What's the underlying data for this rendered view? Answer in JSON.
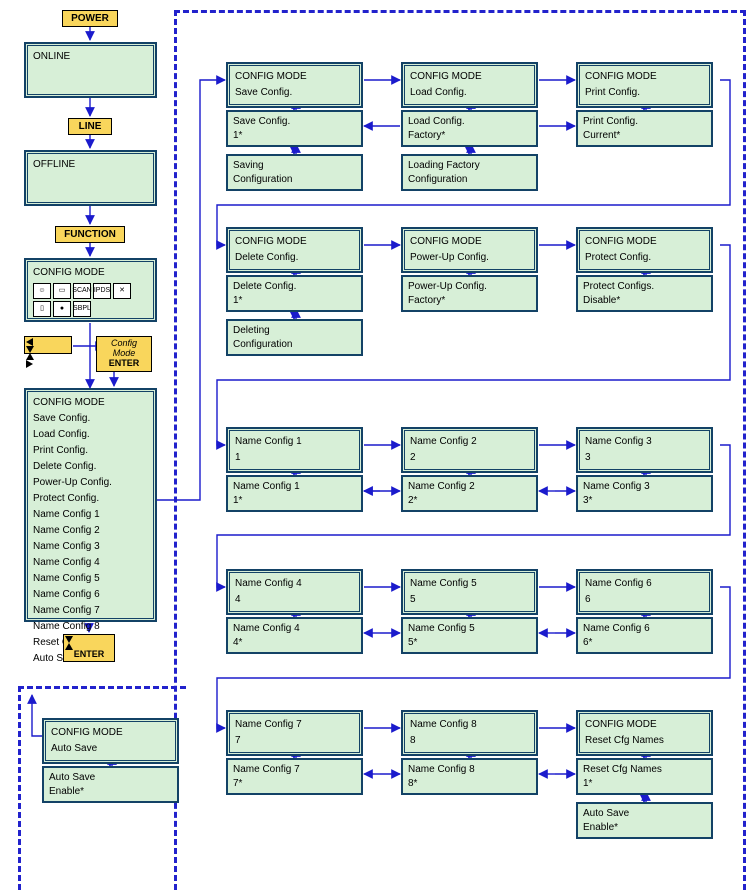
{
  "buttons": {
    "power": "POWER",
    "line": "LINE",
    "function": "FUNCTION",
    "config_mode": "Config Mode",
    "enter": "ENTER",
    "enter2": "ENTER"
  },
  "screens": {
    "online": "ONLINE",
    "offline": "OFFLINE",
    "config_mode": "CONFIG MODE",
    "menu_title": "CONFIG MODE",
    "menu": [
      "Save Config.",
      "Load Config.",
      "Print Config.",
      "Delete Config.",
      "Power-Up Config.",
      "Protect Config.",
      "Name Config 1",
      "Name Config 2",
      "Name Config 3",
      "Name Config 4",
      "Name Config 5",
      "Name Config 6",
      "Name Config 7",
      "Name Config 8",
      "Reset Cfg Names",
      "Auto Save"
    ]
  },
  "icons": {
    "face": "☺",
    "box": "▭",
    "scan": "SCAN",
    "ipds": "IPDS",
    "tools": "✕",
    "doc": "▯",
    "led": "●",
    "sbpl": "SBPL"
  },
  "row1": {
    "save": {
      "t": "CONFIG MODE",
      "s": "Save Config.",
      "p1": "Save Config.",
      "p2": "1*",
      "r1": "Saving",
      "r2": "Configuration"
    },
    "load": {
      "t": "CONFIG MODE",
      "s": "Load Config.",
      "p1": "Load Config.",
      "p2": "Factory*",
      "r1": "Loading Factory",
      "r2": "Configuration"
    },
    "print": {
      "t": "CONFIG MODE",
      "s": "Print Config.",
      "p1": "Print Config.",
      "p2": "Current*"
    }
  },
  "row2": {
    "del": {
      "t": "CONFIG MODE",
      "s": "Delete Config.",
      "p1": "Delete Config.",
      "p2": "1*",
      "r1": "Deleting",
      "r2": "Configuration"
    },
    "pow": {
      "t": "CONFIG MODE",
      "s": "Power-Up Config.",
      "p1": "Power-Up Config.",
      "p2": "Factory*"
    },
    "prot": {
      "t": "CONFIG MODE",
      "s": "Protect Config.",
      "p1": "Protect Configs.",
      "p2": "Disable*"
    }
  },
  "row3": {
    "a": {
      "t": "Name Config 1",
      "s": "1",
      "p1": "Name Config 1",
      "p2": "1*"
    },
    "b": {
      "t": "Name Config 2",
      "s": "2",
      "p1": "Name Config 2",
      "p2": "2*"
    },
    "c": {
      "t": "Name Config 3",
      "s": "3",
      "p1": "Name Config 3",
      "p2": "3*"
    }
  },
  "row4": {
    "a": {
      "t": "Name Config 4",
      "s": "4",
      "p1": "Name Config 4",
      "p2": "4*"
    },
    "b": {
      "t": "Name Config 5",
      "s": "5",
      "p1": "Name Config 5",
      "p2": "5*"
    },
    "c": {
      "t": "Name Config 6",
      "s": "6",
      "p1": "Name Config 6",
      "p2": "6*"
    }
  },
  "row5": {
    "a": {
      "t": "Name Config 7",
      "s": "7",
      "p1": "Name Config 7",
      "p2": "7*"
    },
    "b": {
      "t": "Name Config 8",
      "s": "8",
      "p1": "Name Config 8",
      "p2": "8*"
    },
    "c": {
      "t": "CONFIG MODE",
      "s": "Reset Cfg Names",
      "p1": "Reset Cfg Names",
      "p2": "1*",
      "q1": "Auto Save",
      "q2": "Enable*"
    }
  },
  "autosave": {
    "t": "CONFIG MODE",
    "s": "Auto Save",
    "p1": "Auto Save",
    "p2": "Enable*"
  }
}
